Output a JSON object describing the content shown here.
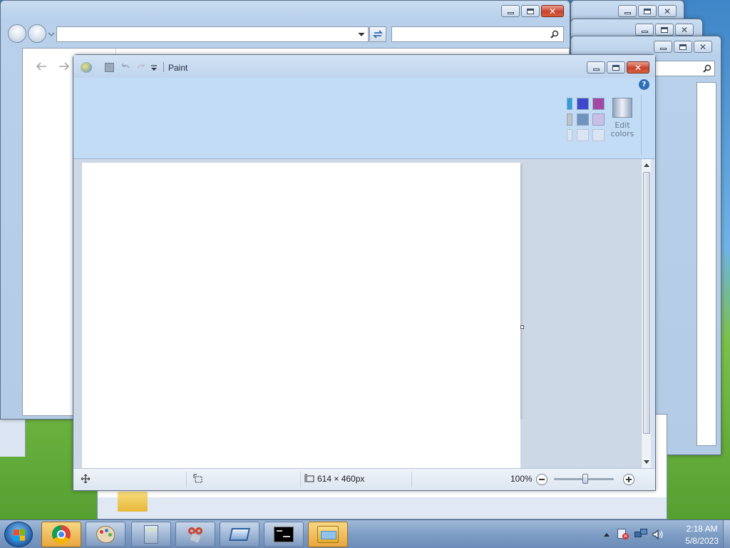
{
  "paint": {
    "title": "Paint",
    "edit_colors_line1": "Edit",
    "edit_colors_line2": "colors",
    "help_glyph": "?",
    "status": {
      "canvas_size": "614 × 460px",
      "zoom": "100%",
      "zoom_value": 0.52
    },
    "palette": [
      "#2b9fe0",
      "#3f48cc",
      "#a349a4",
      "#c3c3c3",
      "#7092be",
      "#c8bfe7",
      "#ffffff",
      "#eef0f4",
      "#eef0f4"
    ]
  },
  "taskbar": {
    "clock_time": "2:18 AM",
    "clock_date": "5/8/2023"
  },
  "icons": {
    "chrome": "chrome-icon",
    "paint": "paint-icon",
    "calculator": "calculator-icon",
    "snipping": "snipping-tool-icon",
    "rdp": "remote-desktop-icon",
    "cmd": "command-prompt-icon",
    "explorer": "file-explorer-icon"
  },
  "colors": {
    "ribbon": "#c3dcf6",
    "titlebar": "#bad0ea",
    "canvas_bg": "#cdd8e6"
  }
}
